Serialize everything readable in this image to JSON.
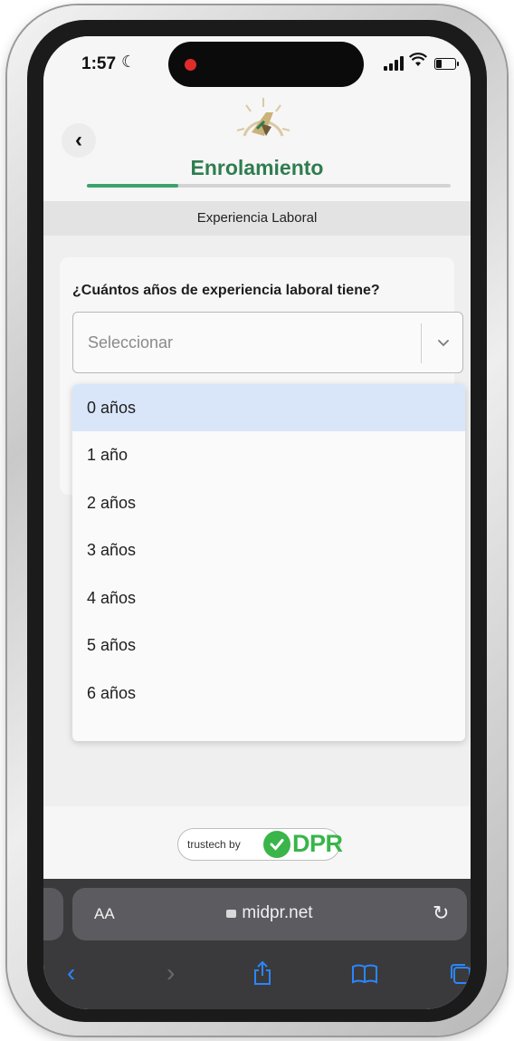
{
  "status_bar": {
    "time": "1:57",
    "battery_level": 0.35
  },
  "header": {
    "back_icon": "chevron-left-icon",
    "title": "Enrolamiento",
    "progress": 0.25,
    "accent_color": "#2f7d4f"
  },
  "section": {
    "title": "Experiencia Laboral"
  },
  "form": {
    "question": "¿Cuántos años de experiencia laboral tiene?",
    "select": {
      "placeholder": "Seleccionar",
      "options": [
        "0 años",
        "1 año",
        "2 años",
        "3 años",
        "4 años",
        "5 años",
        "6 años"
      ],
      "highlighted_index": 0
    }
  },
  "footer": {
    "badge_prefix": "trustech by",
    "brand": "DPR",
    "brand_color": "#39b54a"
  },
  "browser": {
    "aa_label": "AA",
    "url": "midpr.net",
    "nav_icons": [
      "back-icon",
      "forward-icon",
      "share-icon",
      "bookmarks-icon",
      "tabs-icon"
    ]
  }
}
